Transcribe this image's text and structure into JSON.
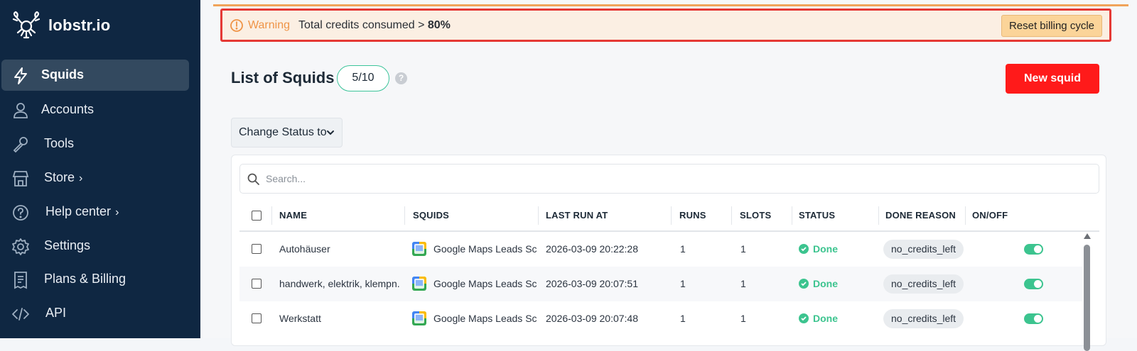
{
  "brand": {
    "name": "lobstr.io"
  },
  "sidebar": {
    "items": [
      {
        "label": "Squids",
        "icon": "lightning-icon",
        "active": true
      },
      {
        "label": "Accounts",
        "icon": "user-icon"
      },
      {
        "label": "Tools",
        "icon": "wrench-icon"
      },
      {
        "label": "Store",
        "icon": "store-icon",
        "chevron": "›"
      },
      {
        "label": "Help center",
        "icon": "help-circle-icon",
        "chevron": "›"
      },
      {
        "label": "Settings",
        "icon": "gear-icon"
      },
      {
        "label": "Plans & Billing",
        "icon": "receipt-icon"
      },
      {
        "label": "API",
        "icon": "code-icon"
      }
    ]
  },
  "warning": {
    "label": "Warning",
    "message_prefix": "Total credits consumed > ",
    "message_value": "80%",
    "action": "Reset billing cycle"
  },
  "page": {
    "title": "List of Squids",
    "count": "5/10",
    "help": "?",
    "new_button": "New squid",
    "status_dropdown": "Change Status to",
    "search_placeholder": "Search..."
  },
  "table": {
    "columns": [
      "NAME",
      "SQUIDS",
      "LAST RUN AT",
      "RUNS",
      "SLOTS",
      "STATUS",
      "DONE REASON",
      "ON/OFF"
    ],
    "rows": [
      {
        "name": "Autohäuser",
        "squid": "Google Maps Leads Scraper",
        "last_run": "2026-03-09 20:22:28",
        "runs": "1",
        "slots": "1",
        "status": "Done",
        "reason": "no_credits_left",
        "on": true
      },
      {
        "name": "handwerk, elektrik, klempn...",
        "squid": "Google Maps Leads Scraper",
        "last_run": "2026-03-09 20:07:51",
        "runs": "1",
        "slots": "1",
        "status": "Done",
        "reason": "no_credits_left",
        "on": true
      },
      {
        "name": "Werkstatt",
        "squid": "Google Maps Leads Scraper",
        "last_run": "2026-03-09 20:07:48",
        "runs": "1",
        "slots": "1",
        "status": "Done",
        "reason": "no_credits_left",
        "on": true
      }
    ]
  },
  "colors": {
    "sidebar_bg": "#0f2742",
    "accent_red": "#ff1a1a",
    "done_green": "#3cc48f",
    "warning_orange": "#ef9447"
  }
}
